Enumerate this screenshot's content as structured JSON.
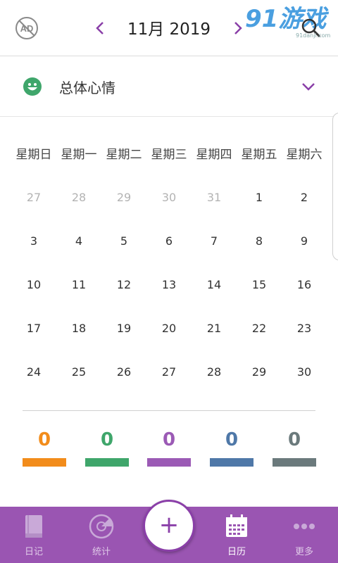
{
  "header": {
    "month_title": "11月 2019",
    "watermark_text": "91danji.com",
    "watermark_logo_text": "91游戏"
  },
  "filter": {
    "label": "总体心情",
    "icon": "smiley-face-icon"
  },
  "calendar": {
    "weekdays": [
      "星期日",
      "星期一",
      "星期二",
      "星期三",
      "星期四",
      "星期五",
      "星期六"
    ],
    "weeks": [
      [
        "27",
        "28",
        "29",
        "30",
        "31",
        "1",
        "2"
      ],
      [
        "3",
        "4",
        "5",
        "6",
        "7",
        "8",
        "9"
      ],
      [
        "10",
        "11",
        "12",
        "13",
        "14",
        "15",
        "16"
      ],
      [
        "17",
        "18",
        "19",
        "20",
        "21",
        "22",
        "23"
      ],
      [
        "24",
        "25",
        "26",
        "27",
        "28",
        "29",
        "30"
      ]
    ],
    "leading_other_month_days": 5
  },
  "mood_stats": [
    {
      "count": "0",
      "color": "#f28c1b"
    },
    {
      "count": "0",
      "color": "#3fa66b"
    },
    {
      "count": "0",
      "color": "#9b5ab5"
    },
    {
      "count": "0",
      "color": "#4f78a8"
    },
    {
      "count": "0",
      "color": "#6b7a7c"
    }
  ],
  "bottom_nav": {
    "items": [
      {
        "label": "日记",
        "icon": "diary-book-icon",
        "active": false
      },
      {
        "label": "统计",
        "icon": "statistics-disc-icon",
        "active": false
      },
      {
        "label": "日历",
        "icon": "calendar-icon",
        "active": true
      },
      {
        "label": "更多",
        "icon": "more-dots-icon",
        "active": false
      }
    ],
    "fab": {
      "label": "+",
      "icon": "add-icon"
    }
  },
  "colors": {
    "accent": "#9a55b2",
    "chevron": "#8a3fa8",
    "face": "#3fa66b"
  }
}
